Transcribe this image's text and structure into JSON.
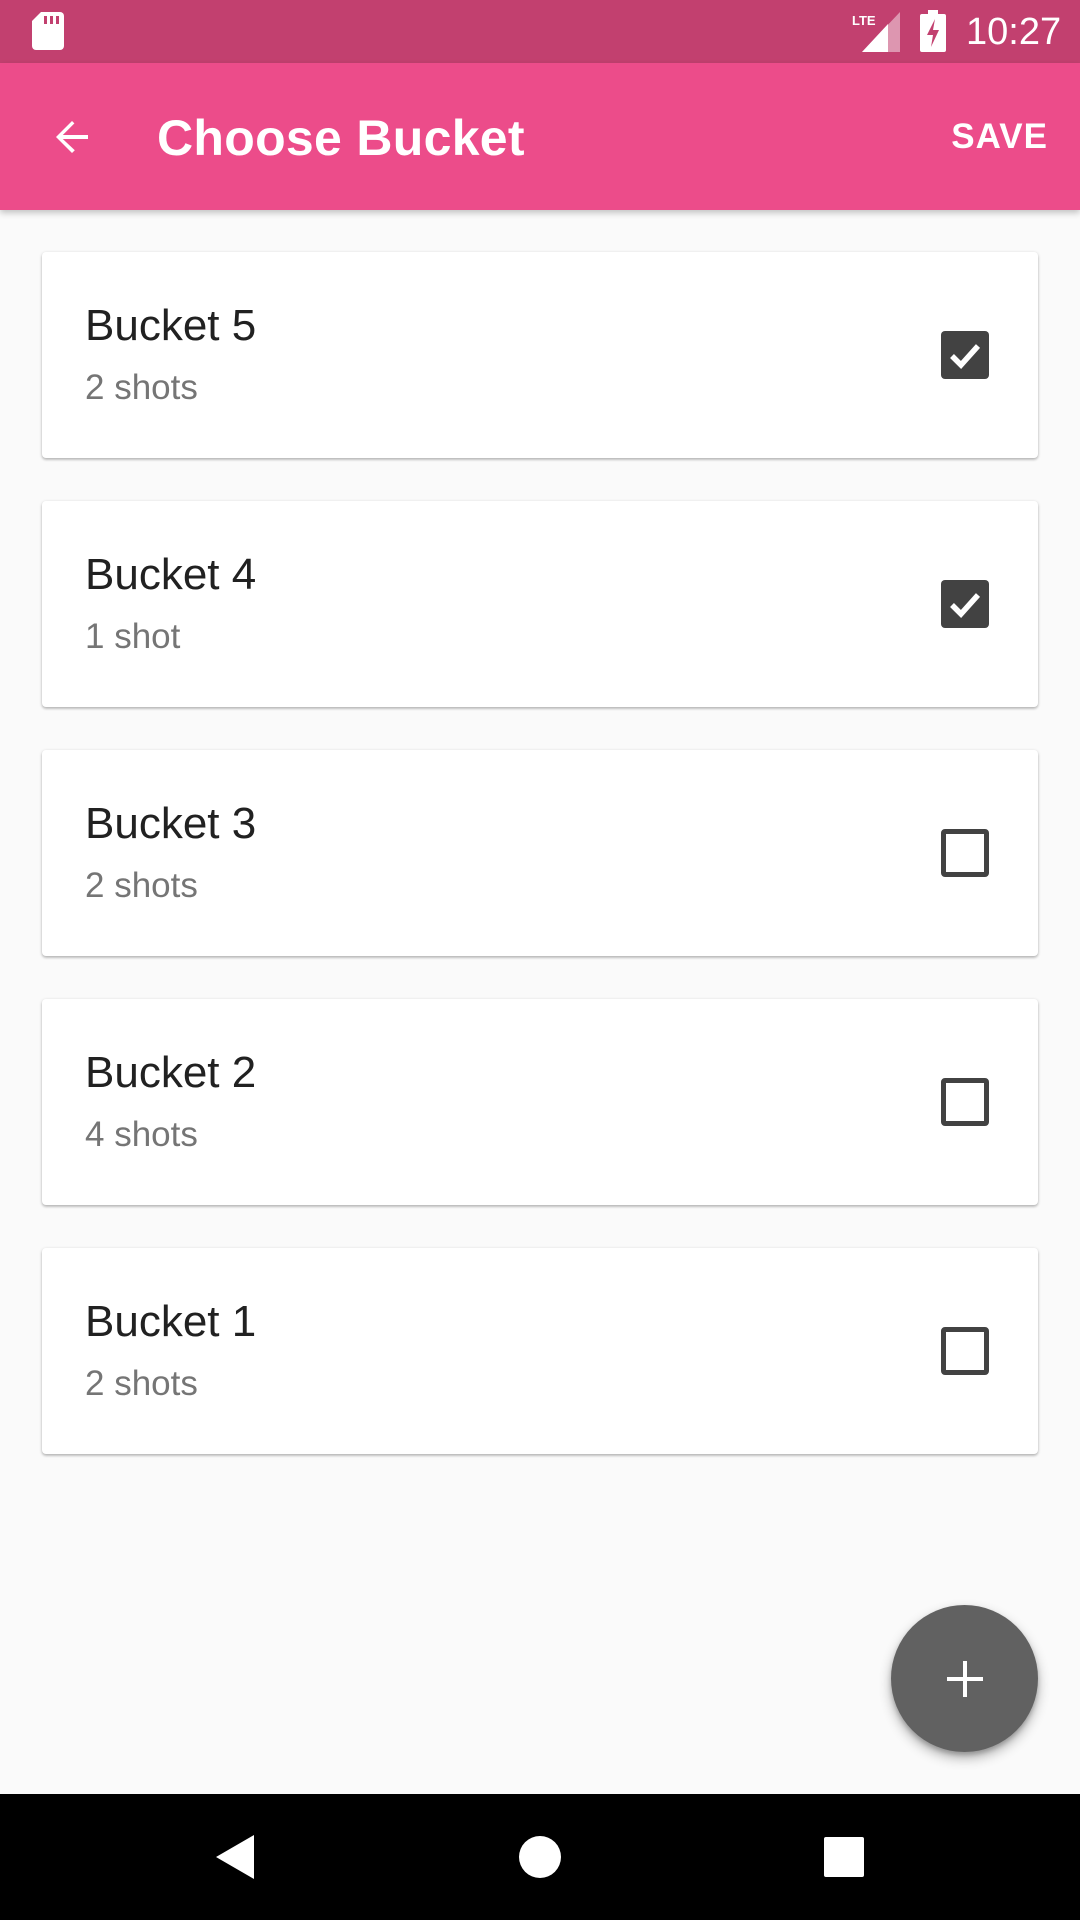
{
  "status_bar": {
    "time": "10:27",
    "network_label": "LTE",
    "icons": [
      "sd-card-icon",
      "lte-signal-icon",
      "battery-charging-icon"
    ]
  },
  "app_bar": {
    "title": "Choose Bucket",
    "save_label": "SAVE",
    "back_icon": "arrow-back-icon",
    "color": "#ec4c8a"
  },
  "buckets": [
    {
      "name": "Bucket 5",
      "count": "2 shots",
      "checked": true
    },
    {
      "name": "Bucket 4",
      "count": "1 shot",
      "checked": true
    },
    {
      "name": "Bucket 3",
      "count": "2 shots",
      "checked": false
    },
    {
      "name": "Bucket 2",
      "count": "4 shots",
      "checked": false
    },
    {
      "name": "Bucket 1",
      "count": "2 shots",
      "checked": false
    }
  ],
  "fab": {
    "icon": "plus-icon"
  },
  "nav": {
    "icons": [
      "back-triangle-icon",
      "home-circle-icon",
      "recents-square-icon"
    ]
  },
  "colors": {
    "status_bar": "#c2406f",
    "app_bar": "#ec4c8a",
    "checkbox": "#424242",
    "fab": "#616161",
    "background": "#fafafa"
  }
}
